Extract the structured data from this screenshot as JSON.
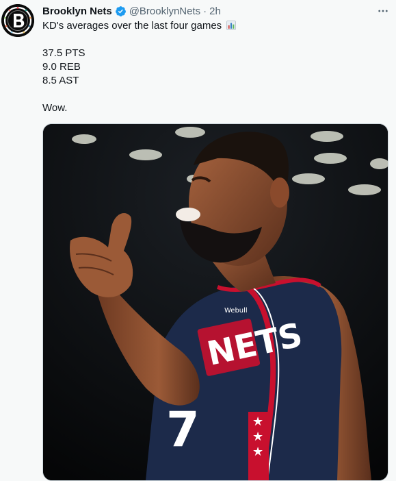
{
  "tweet": {
    "account": {
      "display_name": "Brooklyn Nets",
      "handle": "@BrooklynNets",
      "separator": "·",
      "time": "2h",
      "verified": true,
      "avatar_icon": "brooklyn-nets-logo-icon"
    },
    "more_icon": "more-options-icon",
    "body": {
      "headline": "KD's averages over the last four games",
      "headline_emoji": "bar-chart-emoji",
      "stats": [
        "37.5 PTS",
        "9.0 REB",
        "8.5 AST"
      ],
      "closing": "Wow."
    },
    "media": {
      "description_icon": "player-photo",
      "jersey_text": "NETS",
      "jersey_sponsor": "Webull"
    }
  },
  "colors": {
    "background": "#f7f9f9",
    "text": "#0f1419",
    "secondary_text": "#536471",
    "verified_blue": "#1d9bf0",
    "jersey_navy": "#1c2a4a",
    "jersey_red": "#c8102e"
  }
}
